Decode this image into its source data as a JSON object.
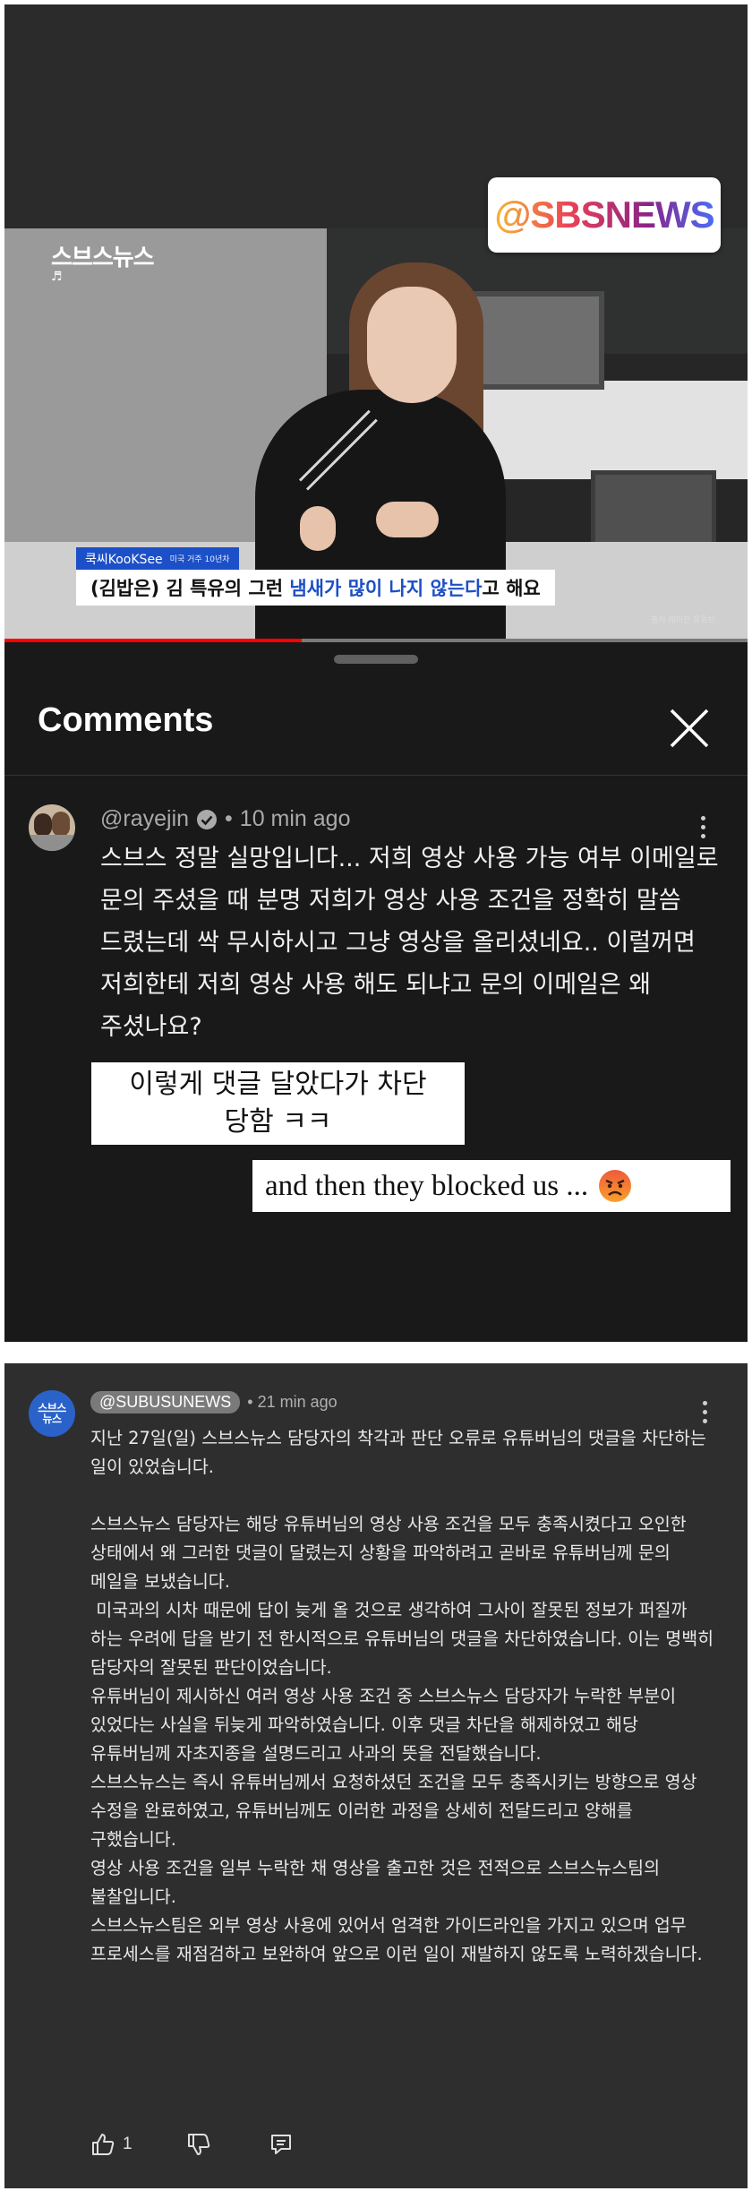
{
  "video": {
    "channel_logo": "스브스뉴스",
    "channel_note_icon": "♬",
    "instagram_tag": "@SBSNEWS",
    "speaker_name": "쿡씨KooKSee",
    "speaker_sub": "미국 거주 10년차",
    "subtitle_prefix": "(김밥은) 김 특유의 그런 ",
    "subtitle_highlight": "냄새가 많이 나지 않는다",
    "subtitle_suffix": "고 해요",
    "source_label": "출처 레이진 유튜브",
    "progress_fraction": 0.4
  },
  "comments_sheet": {
    "title": "Comments",
    "close_icon": "close-icon"
  },
  "comment1": {
    "handle": "@rayejin",
    "verified_icon": "verified-check-icon",
    "separator": "•",
    "time": "10 min ago",
    "text": "스브스 정말 실망입니다... 저희 영상 사용 가능 여부 이메일로 문의 주셨을 때 분명 저희가 영상 사용 조건을 정확히 말씀 드렸는데 싹 무시하시고 그냥 영상을 올리셨네요.. 이럴꺼면 저희한테 저희 영상 사용 해도 되냐고 문의 이메일은 왜 주셨나요?"
  },
  "caption_overlays": {
    "korean_line1": "이렇게 댓글 달았다가 차단",
    "korean_line2": "당함 ㅋㅋ",
    "english": "and then they blocked us ...",
    "emoji_icon": "angry-face-icon"
  },
  "comment2": {
    "avatar_text_line1": "스브스",
    "avatar_text_line2": "뉴스",
    "handle": "@SUBUSUNEWS",
    "separator": "•",
    "time": "21 min ago",
    "paragraphs": [
      "지난 27일(일) 스브스뉴스 담당자의 착각과 판단 오류로 유튜버님의 댓글을 차단하는 일이 있었습니다.",
      "스브스뉴스 담당자는 해당 유튜버님의 영상 사용 조건을 모두 충족시켰다고 오인한 상태에서 왜 그러한 댓글이 달렸는지 상황을 파악하려고 곧바로 유튜버님께 문의 메일을 보냈습니다.",
      " 미국과의 시차 때문에 답이 늦게 올 것으로 생각하여 그사이 잘못된 정보가 퍼질까 하는 우려에 답을 받기 전 한시적으로 유튜버님의 댓글을 차단하였습니다. 이는 명백히 담당자의 잘못된 판단이었습니다.",
      "유튜버님이 제시하신 여러 영상 사용 조건 중 스브스뉴스 담당자가 누락한 부분이 있었다는 사실을 뒤늦게 파악하였습니다. 이후 댓글 차단을 해제하였고 해당 유튜버님께 자초지종을 설명드리고 사과의 뜻을 전달했습니다.",
      "스브스뉴스는 즉시 유튜버님께서 요청하셨던 조건을 모두 충족시키는 방향으로 영상 수정을 완료하였고, 유튜버님께도 이러한 과정을 상세히 전달드리고 양해를 구했습니다.",
      "영상 사용 조건을 일부 누락한 채 영상을 출고한 것은 전적으로 스브스뉴스팀의 불찰입니다.",
      "스브스뉴스팀은 외부 영상 사용에 있어서 엄격한 가이드라인을 가지고 있으며 업무 프로세스를 재점검하고 보완하여 앞으로 이런 일이 재발하지 않도록 노력하겠습니다."
    ],
    "like_count": "1",
    "like_icon": "thumbs-up-icon",
    "dislike_icon": "thumbs-down-icon",
    "reply_icon": "reply-icon"
  }
}
